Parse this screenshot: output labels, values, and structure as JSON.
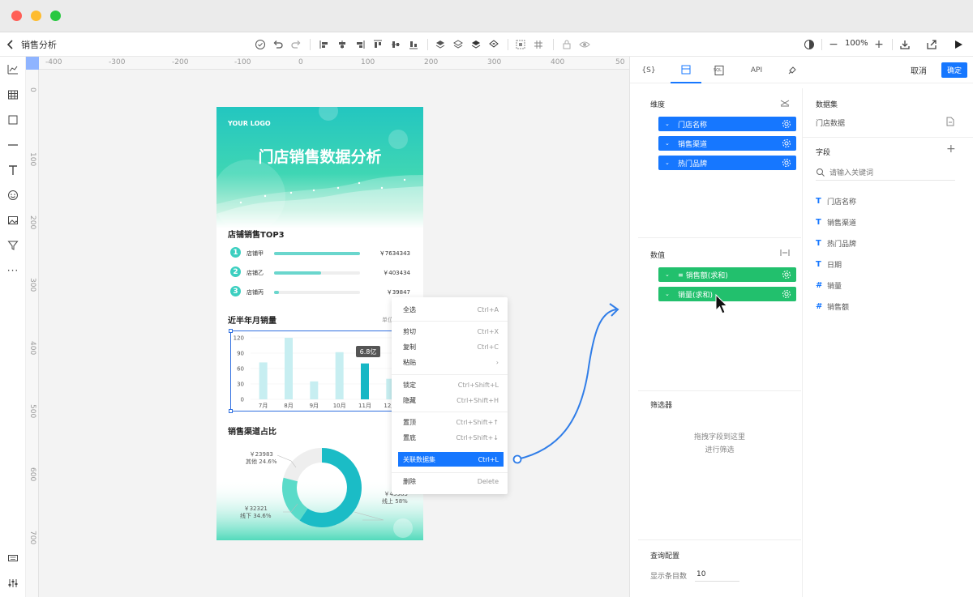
{
  "window": {
    "traffic_colors": [
      "#ff5f57",
      "#febc2e",
      "#28c840"
    ]
  },
  "toolbar": {
    "back_label": "销售分析",
    "zoom": "100%",
    "zoom_minus": "−",
    "zoom_plus": "+"
  },
  "ruler": {
    "top": [
      "-400",
      "-300",
      "-200",
      "-100",
      "0",
      "100",
      "200",
      "300",
      "400",
      "50"
    ],
    "left": [
      "0",
      "100",
      "200",
      "300",
      "400",
      "500",
      "600",
      "700"
    ]
  },
  "poster": {
    "logo": "YOUR LOGO",
    "title": "门店销售数据分析",
    "top3": {
      "title": "店铺销售TOP3",
      "items": [
        {
          "rank": "1",
          "name": "店铺甲",
          "value": "￥7634343",
          "fill": 1.0
        },
        {
          "rank": "2",
          "name": "店铺乙",
          "value": "￥403434",
          "fill": 0.55
        },
        {
          "rank": "3",
          "name": "店铺丙",
          "value": "￥39847",
          "fill": 0.06
        }
      ]
    },
    "monthly": {
      "title": "近半年月销量",
      "unit": "单位",
      "tooltip": "6.8亿"
    },
    "channel": {
      "title": "销售渠道占比",
      "labels": [
        {
          "value": "￥23983",
          "name": "其他",
          "pct": "24.6%"
        },
        {
          "value": "￥32321",
          "name": "线下",
          "pct": "34.6%"
        },
        {
          "value": "￥45983",
          "name": "线上",
          "pct": "58%"
        }
      ]
    }
  },
  "chart_data": {
    "type": "bar",
    "categories": [
      "7月",
      "8月",
      "9月",
      "10月",
      "11月",
      "12月"
    ],
    "values": [
      72,
      120,
      35,
      92,
      70,
      40
    ],
    "ylim": [
      0,
      120
    ],
    "yticks": [
      "120",
      "90",
      "60",
      "30",
      "0"
    ],
    "highlight_index": 4,
    "bar_color": "#c7eef1",
    "highlight_color": "#17b7c5"
  },
  "context_menu": {
    "items": [
      {
        "label": "全选",
        "shortcut": "Ctrl+A"
      },
      {
        "label": "剪切",
        "shortcut": "Ctrl+X"
      },
      {
        "label": "复制",
        "shortcut": "Ctrl+C"
      },
      {
        "label": "粘贴",
        "shortcut": "›"
      },
      {
        "label": "锁定",
        "shortcut": "Ctrl+Shift+L"
      },
      {
        "label": "隐藏",
        "shortcut": "Ctrl+Shift+H"
      },
      {
        "label": "置顶",
        "shortcut": "Ctrl+Shift+↑"
      },
      {
        "label": "置底",
        "shortcut": "Ctrl+Shift+↓"
      },
      {
        "label": "关联数据集",
        "shortcut": "Ctrl+L"
      },
      {
        "label": "删除",
        "shortcut": "Delete"
      }
    ]
  },
  "panel": {
    "tabs": [
      "{S}",
      "",
      "SQL",
      "API",
      ""
    ],
    "cancel": "取消",
    "confirm": "确定",
    "dimension": {
      "title": "维度",
      "pills": [
        "门店名称",
        "销售渠道",
        "热门品牌"
      ]
    },
    "measure": {
      "title": "数值",
      "pills": [
        "销售额(求和)",
        "销量(求和)"
      ]
    },
    "filter": {
      "title": "筛选器",
      "hint1": "拖拽字段到这里",
      "hint2": "进行筛选"
    },
    "query": {
      "title": "查询配置",
      "count_label": "显示条目数",
      "count_value": "10"
    },
    "dataset": {
      "title": "数据集",
      "name": "门店数据"
    },
    "fields": {
      "title": "字段",
      "search_placeholder": "请输入关键词",
      "items": [
        {
          "icon": "T",
          "name": "门店名称"
        },
        {
          "icon": "T",
          "name": "销售渠道"
        },
        {
          "icon": "T",
          "name": "热门品牌"
        },
        {
          "icon": "T",
          "name": "日期"
        },
        {
          "icon": "#",
          "name": "销量"
        },
        {
          "icon": "#",
          "name": "销售额"
        }
      ]
    }
  },
  "colors": {
    "primary": "#1677ff",
    "green": "#22c06d",
    "teal": "#3ccfc0"
  }
}
